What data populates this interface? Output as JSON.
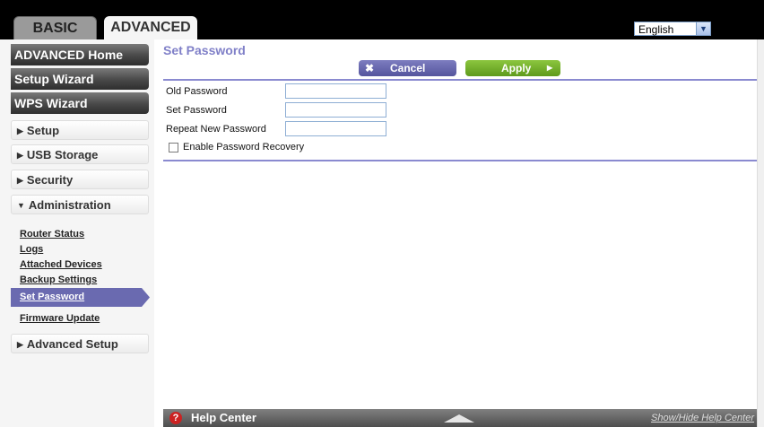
{
  "tabs": {
    "basic": "BASIC",
    "advanced": "ADVANCED"
  },
  "language": {
    "selected": "English"
  },
  "sidebar": {
    "primary": [
      "ADVANCED Home",
      "Setup Wizard",
      "WPS Wizard"
    ],
    "sections": [
      "Setup",
      "USB Storage",
      "Security",
      "Administration",
      "Advanced Setup"
    ],
    "admin_items": [
      "Router Status",
      "Logs",
      "Attached Devices",
      "Backup Settings",
      "Set Password",
      "Firmware Update"
    ]
  },
  "page": {
    "title": "Set Password",
    "cancel_label": "Cancel",
    "apply_label": "Apply"
  },
  "form": {
    "old_password_label": "Old Password",
    "set_password_label": "Set Password",
    "repeat_password_label": "Repeat New Password",
    "recovery_label": "Enable Password Recovery",
    "recovery_checked": false
  },
  "help": {
    "title": "Help Center",
    "toggle": "Show/Hide Help Center"
  },
  "colors": {
    "accent": "#8080c8",
    "apply": "#7ab32e",
    "cancel": "#6a6ab0"
  }
}
